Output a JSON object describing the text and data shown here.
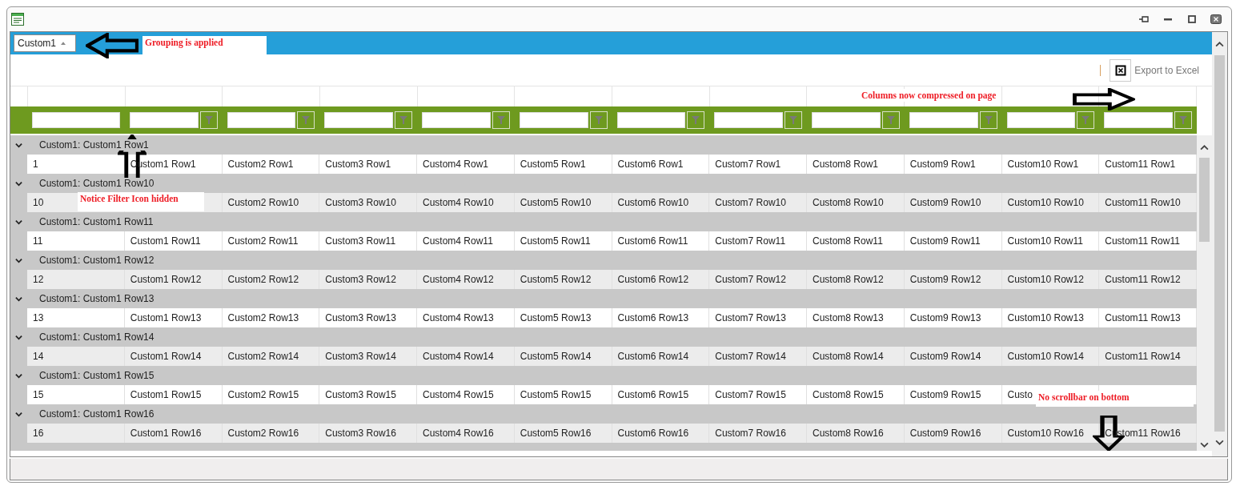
{
  "window": {
    "controls": [
      {
        "kind": "pin"
      },
      {
        "kind": "minimize"
      },
      {
        "kind": "maximize"
      },
      {
        "kind": "close"
      }
    ]
  },
  "group_panel": {
    "field": "Custom1"
  },
  "toolbar": {
    "export_label": "Export to Excel"
  },
  "table": {
    "filters": [
      {
        "button": false
      },
      {
        "button": true
      },
      {
        "button": true
      },
      {
        "button": true
      },
      {
        "button": true
      },
      {
        "button": true
      },
      {
        "button": true
      },
      {
        "button": true
      },
      {
        "button": true
      },
      {
        "button": true
      },
      {
        "button": true
      },
      {
        "button": true
      }
    ],
    "groups": [
      {
        "header": "Custom1: Custom1 Row1",
        "expanded": true,
        "cells": [
          "1",
          "Custom1 Row1",
          "Custom2 Row1",
          "Custom3 Row1",
          "Custom4 Row1",
          "Custom5 Row1",
          "Custom6 Row1",
          "Custom7 Row1",
          "Custom8 Row1",
          "Custom9 Row1",
          "Custom10 Row1",
          "Custom11 Row1"
        ]
      },
      {
        "header": "Custom1: Custom1 Row10",
        "expanded": true,
        "cells": [
          "10",
          null,
          "Custom2 Row10",
          "Custom3 Row10",
          "Custom4 Row10",
          "Custom5 Row10",
          "Custom6 Row10",
          "Custom7 Row10",
          "Custom8 Row10",
          "Custom9 Row10",
          "Custom10 Row10",
          "Custom11 Row10"
        ]
      },
      {
        "header": "Custom1: Custom1 Row11",
        "expanded": true,
        "cells": [
          "11",
          "Custom1 Row11",
          "Custom2 Row11",
          "Custom3 Row11",
          "Custom4 Row11",
          "Custom5 Row11",
          "Custom6 Row11",
          "Custom7 Row11",
          "Custom8 Row11",
          "Custom9 Row11",
          "Custom10 Row11",
          "Custom11 Row11"
        ]
      },
      {
        "header": "Custom1: Custom1 Row12",
        "expanded": true,
        "cells": [
          "12",
          "Custom1 Row12",
          "Custom2 Row12",
          "Custom3 Row12",
          "Custom4 Row12",
          "Custom5 Row12",
          "Custom6 Row12",
          "Custom7 Row12",
          "Custom8 Row12",
          "Custom9 Row12",
          "Custom10 Row12",
          "Custom11 Row12"
        ]
      },
      {
        "header": "Custom1: Custom1 Row13",
        "expanded": true,
        "cells": [
          "13",
          "Custom1 Row13",
          "Custom2 Row13",
          "Custom3 Row13",
          "Custom4 Row13",
          "Custom5 Row13",
          "Custom6 Row13",
          "Custom7 Row13",
          "Custom8 Row13",
          "Custom9 Row13",
          "Custom10 Row13",
          "Custom11 Row13"
        ]
      },
      {
        "header": "Custom1: Custom1 Row14",
        "expanded": true,
        "cells": [
          "14",
          "Custom1 Row14",
          "Custom2 Row14",
          "Custom3 Row14",
          "Custom4 Row14",
          "Custom5 Row14",
          "Custom6 Row14",
          "Custom7 Row14",
          "Custom8 Row14",
          "Custom9 Row14",
          "Custom10 Row14",
          "Custom11 Row14"
        ]
      },
      {
        "header": "Custom1: Custom1 Row15",
        "expanded": true,
        "cells": [
          "15",
          "Custom1 Row15",
          "Custom2 Row15",
          "Custom3 Row15",
          "Custom4 Row15",
          "Custom5 Row15",
          "Custom6 Row15",
          "Custom7 Row15",
          "Custom8 Row15",
          "Custom9 Row15",
          "Custo",
          null
        ]
      },
      {
        "header": "Custom1: Custom1 Row16",
        "expanded": true,
        "cells": [
          "16",
          "Custom1 Row16",
          "Custom2 Row16",
          "Custom3 Row16",
          "Custom4 Row16",
          "Custom5 Row16",
          "Custom6 Row16",
          "Custom7 Row16",
          "Custom8 Row16",
          "Custom9 Row16",
          "Custom10 Row16",
          "Custom11 Row16"
        ]
      }
    ]
  },
  "annotations": [
    {
      "text": "Grouping is applied",
      "kind": "left"
    },
    {
      "text": "Columns now compressed on page",
      "kind": "right"
    },
    {
      "text": "Notice Filter Icon hidden",
      "kind": "up"
    },
    {
      "text": "No scrollbar on bottom",
      "kind": "down"
    }
  ]
}
